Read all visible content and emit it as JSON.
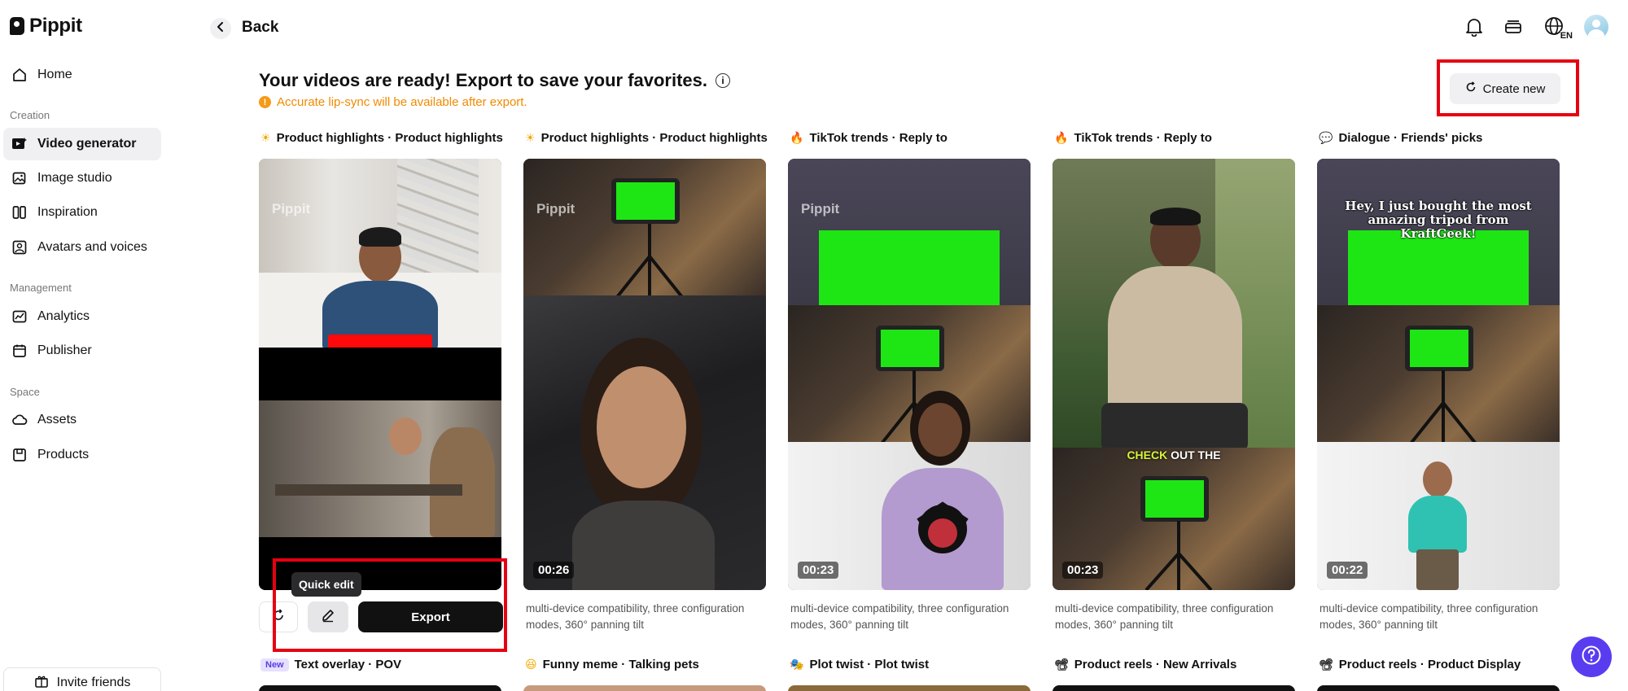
{
  "app": {
    "name": "Pippit"
  },
  "sidebar": {
    "items": [
      {
        "label": "Home",
        "icon": "home-icon"
      },
      {
        "label": "Video generator",
        "icon": "video-generator-icon",
        "active": true
      },
      {
        "label": "Image studio",
        "icon": "image-studio-icon"
      },
      {
        "label": "Inspiration",
        "icon": "inspiration-icon"
      },
      {
        "label": "Avatars and voices",
        "icon": "avatar-voice-icon"
      },
      {
        "label": "Analytics",
        "icon": "analytics-icon"
      },
      {
        "label": "Publisher",
        "icon": "calendar-icon"
      },
      {
        "label": "Assets",
        "icon": "cloud-icon"
      },
      {
        "label": "Products",
        "icon": "product-box-icon"
      }
    ],
    "sections": {
      "creation": "Creation",
      "management": "Management",
      "space": "Space"
    },
    "invite_label": "Invite friends"
  },
  "topbar": {
    "back_label": "Back",
    "language": "EN"
  },
  "main": {
    "headline": "Your videos are ready! Export to save your favorites.",
    "notice": "Accurate lip-sync will be available after export.",
    "create_new_label": "Create new"
  },
  "cards": [
    {
      "emoji": "☀",
      "title": "Product highlights · Product highlights",
      "duration": "",
      "description": ""
    },
    {
      "emoji": "☀",
      "title": "Product highlights · Product highlights",
      "duration": "00:26",
      "description": "multi-device compatibility, three configuration modes, 360° panning tilt"
    },
    {
      "emoji": "🔥",
      "title": "TikTok trends · Reply to",
      "duration": "00:23",
      "description": "multi-device compatibility, three configuration modes, 360° panning tilt"
    },
    {
      "emoji": "🔥",
      "title": "TikTok trends · Reply to",
      "duration": "00:23",
      "description": "multi-device compatibility, three configuration modes, 360° panning tilt",
      "caption_highlight": "CHECK",
      "caption_rest": "OUT THE"
    },
    {
      "emoji": "💬",
      "title": "Dialogue · Friends' picks",
      "duration": "00:22",
      "description": "multi-device compatibility, three configuration modes, 360° panning tilt",
      "caption": "Hey, I just bought the most amazing tripod from KraftGeek!"
    }
  ],
  "watermark": "Pippit",
  "card1_controls": {
    "tooltip": "Quick edit",
    "export_label": "Export"
  },
  "row2": [
    {
      "badge": "New",
      "title": "Text overlay · POV"
    },
    {
      "emoji": "😆",
      "title": "Funny meme · Talking pets"
    },
    {
      "emoji": "🎭",
      "title": "Plot twist · Plot twist"
    },
    {
      "emoji": "📽",
      "title": "Product reels · New Arrivals"
    },
    {
      "emoji": "📽",
      "title": "Product reels · Product Display"
    }
  ],
  "colors": {
    "accent": "#5a3cf0",
    "notice": "#f08a00",
    "highlight_box": "#e60012",
    "green_screen": "#1ee614"
  }
}
